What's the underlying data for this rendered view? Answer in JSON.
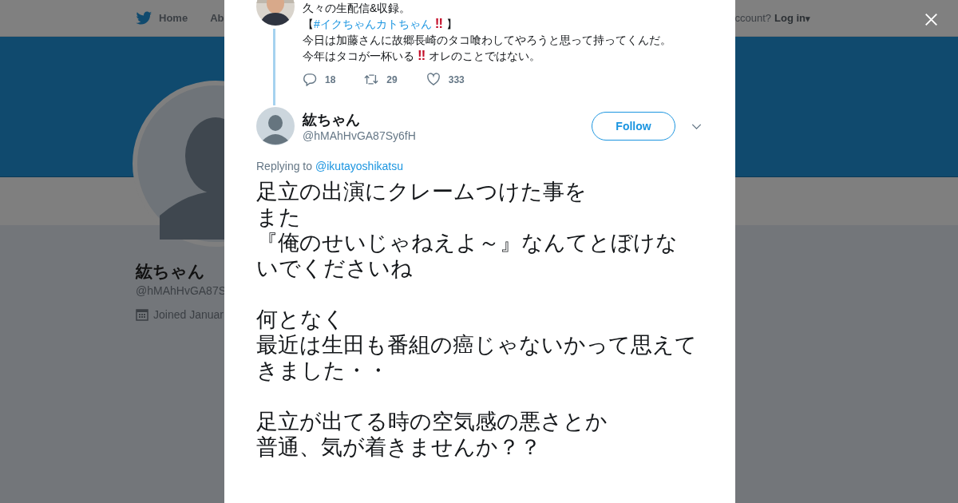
{
  "nav": {
    "home": "Home",
    "about": "Ab",
    "account": "ccount?",
    "login": "Log in",
    "login_caret": "▾"
  },
  "profile": {
    "name": "紘ちゃん",
    "handle": "@hMAhHvGA87S",
    "joined": "Joined Januar"
  },
  "modal": {
    "parent_tweet": {
      "lines": [
        [
          {
            "kind": "plain",
            "text": "久々の生配信&収録。"
          }
        ],
        [
          {
            "kind": "plain",
            "text": "【"
          },
          {
            "kind": "hashtag",
            "text": "#イクちゃんカトちゃん"
          },
          {
            "kind": "emoji",
            "text": "‼"
          },
          {
            "kind": "plain",
            "text": "】"
          }
        ],
        [
          {
            "kind": "plain",
            "text": "今日は加藤さんに故郷長崎のタコ喰わしてやろうと思って持ってくんだ。"
          }
        ],
        [
          {
            "kind": "plain",
            "text": "今年はタコが一杯いる"
          },
          {
            "kind": "emoji",
            "text": "‼"
          },
          {
            "kind": "plain",
            "text": "オレのことではない。"
          }
        ]
      ],
      "actions": [
        {
          "kind": "reply",
          "count": "18"
        },
        {
          "kind": "retweet",
          "count": "29"
        },
        {
          "kind": "like",
          "count": "333"
        }
      ]
    },
    "tweet": {
      "name": "紘ちゃん",
      "handle": "@hMAhHvGA87Sy6fH",
      "follow": "Follow",
      "replying_label": "Replying to",
      "replying_to": "@ikutayoshikatsu",
      "paragraphs": [
        [
          "足立の出演にクレームつけた事を",
          "また",
          "『俺のせいじゃねえよ～』なんてとぼけな",
          "いでくださいね"
        ],
        [
          "何となく",
          "最近は生田も番組の癌じゃないかって思えて",
          "きました・・"
        ],
        [
          "足立が出てる時の空気感の悪さとか",
          "普通、気が着きませんか？？"
        ]
      ]
    }
  }
}
